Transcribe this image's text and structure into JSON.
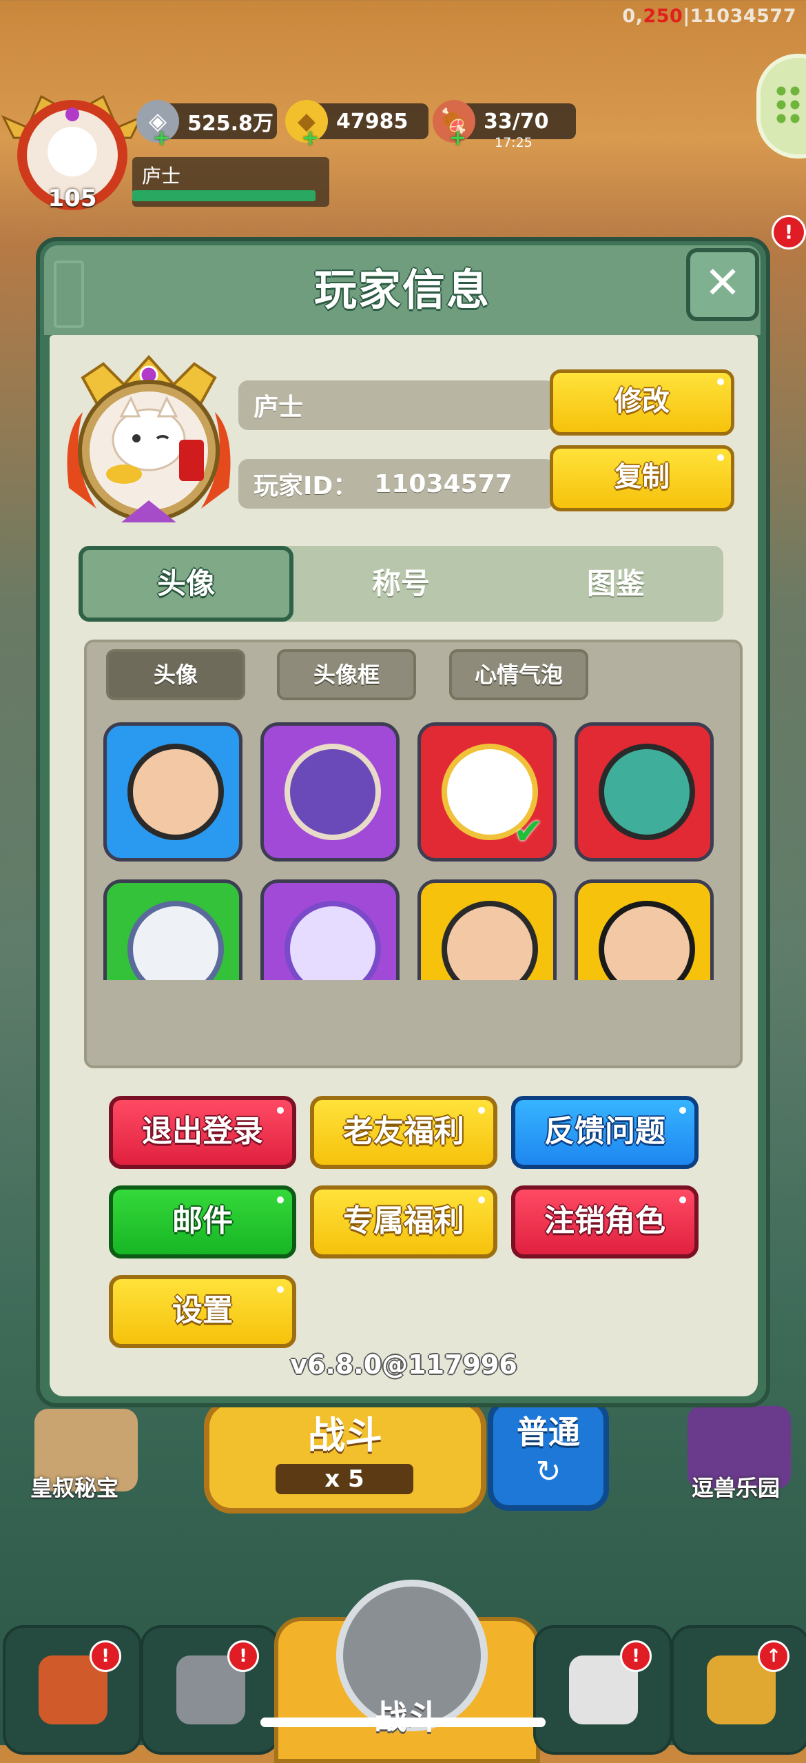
{
  "debug": {
    "a": "0,",
    "b": "250",
    "c": "|11034577"
  },
  "hud": {
    "level": "105",
    "player_name": "庐士",
    "xp_fraction": 0.93,
    "resources": [
      {
        "icon": "coin-icon",
        "value": "525.8万"
      },
      {
        "icon": "gold-ingot-icon",
        "value": "47985"
      },
      {
        "icon": "meat-icon",
        "value": "33/70",
        "timer": "17:25"
      }
    ]
  },
  "background": {
    "battle_label": "战斗",
    "battle_cost": "x 5",
    "mode_label": "普通",
    "left_feature": "皇叔秘宝",
    "right_feature": "逗兽乐园",
    "nav_center_label": "战斗",
    "nav_badges": [
      "!",
      "!",
      "!",
      "↑"
    ]
  },
  "modal": {
    "title": "玩家信息",
    "name_value": "庐士",
    "id_label": "玩家ID：",
    "id_value": "11034577",
    "edit_label": "修改",
    "copy_label": "复制",
    "tabs": [
      {
        "label": "头像",
        "active": true
      },
      {
        "label": "称号"
      },
      {
        "label": "图鉴"
      }
    ],
    "subtabs": [
      {
        "label": "头像",
        "active": true
      },
      {
        "label": "头像框"
      },
      {
        "label": "心情气泡"
      }
    ],
    "selected_avatar_index": 2,
    "actions": {
      "logout": "退出登录",
      "old_friend": "老友福利",
      "feedback": "反馈问题",
      "mail": "邮件",
      "exclusive": "专属福利",
      "delete_role": "注销角色",
      "settings": "设置"
    },
    "version": "v6.8.0@117996"
  },
  "colors": {
    "accent_green": "#3f7358",
    "button_yellow": "#f6c20c",
    "button_red": "#e0213f",
    "button_blue": "#1e86f0",
    "button_green": "#17b625"
  }
}
